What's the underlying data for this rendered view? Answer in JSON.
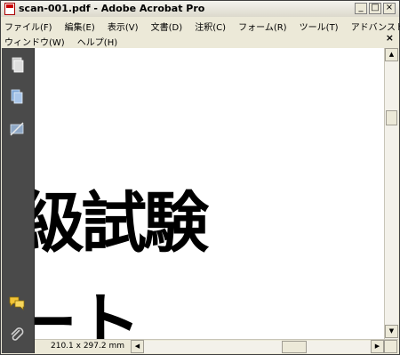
{
  "window": {
    "title": "scan-001.pdf - Adobe Acrobat Pro",
    "controls": {
      "minimize": "_",
      "maximize": "□",
      "close": "×"
    }
  },
  "menu": {
    "row1": [
      "ファイル(F)",
      "編集(E)",
      "表示(V)",
      "文書(D)",
      "注釈(C)",
      "フォーム(R)",
      "ツール(T)",
      "アドバンスト(A)"
    ],
    "row2": [
      "ウィンドウ(W)",
      "ヘルプ(H)"
    ],
    "close": "×"
  },
  "sidebar": {
    "icons": [
      "pages-icon",
      "layers-icon",
      "signatures-icon",
      "comments-icon",
      "attachments-icon"
    ]
  },
  "document": {
    "line1": "級試験",
    "line2": "ート"
  },
  "statusbar": {
    "page_size": "210.1 x 297.2 mm"
  },
  "scroll": {
    "up": "▲",
    "down": "▼",
    "left": "◀",
    "right": "▶"
  }
}
